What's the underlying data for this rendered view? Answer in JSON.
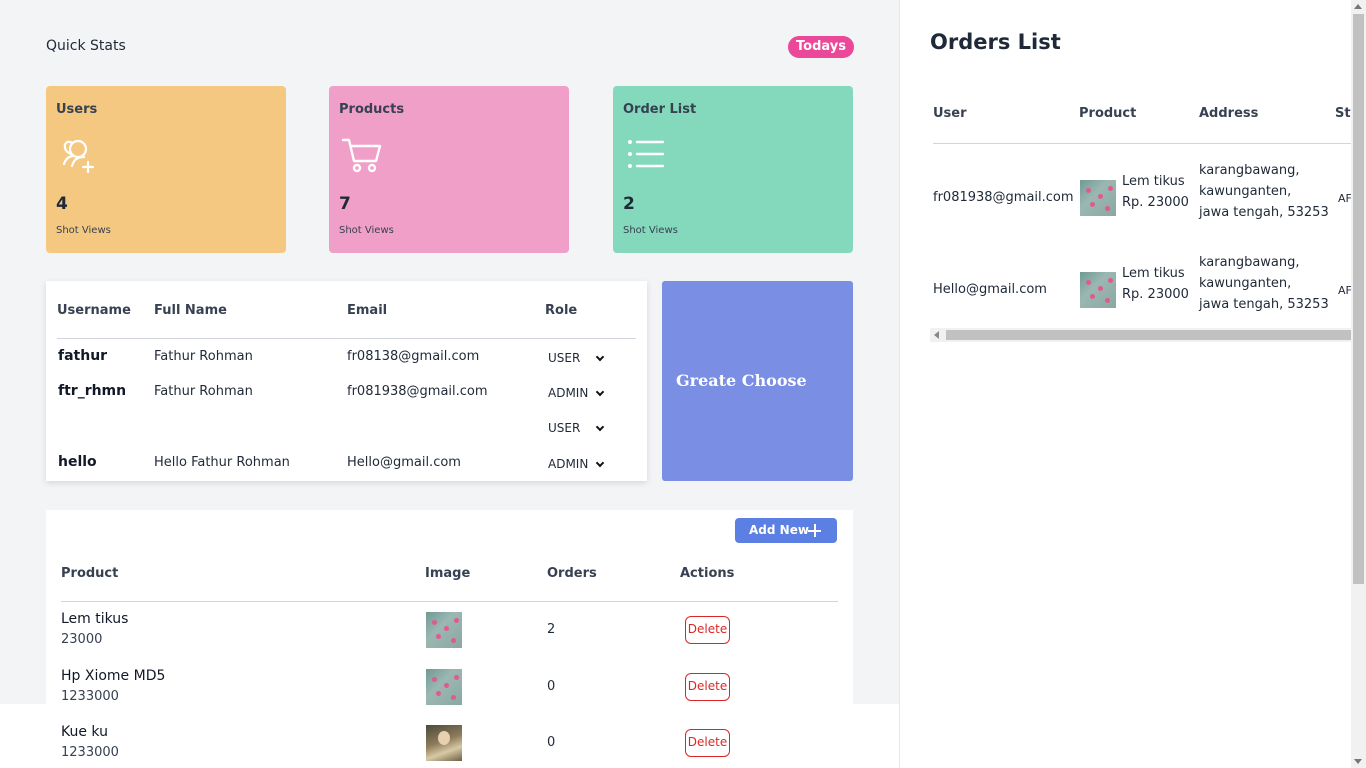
{
  "quick_stats": {
    "title": "Quick Stats",
    "badge": "Todays",
    "cards": [
      {
        "title": "Users",
        "count": "4",
        "sub": "Shot Views",
        "icon": "user-add-icon",
        "color": "#f5c882"
      },
      {
        "title": "Products",
        "count": "7",
        "sub": "Shot Views",
        "icon": "cart-icon",
        "color": "#f09fc8"
      },
      {
        "title": "Order List",
        "count": "2",
        "sub": "Shot Views",
        "icon": "list-icon",
        "color": "#84d9bd"
      }
    ]
  },
  "users_table": {
    "headers": {
      "username": "Username",
      "full_name": "Full Name",
      "email": "Email",
      "role": "Role"
    },
    "rows": [
      {
        "username": "fathur",
        "full_name": "Fathur Rohman",
        "email": "fr08138@gmail.com",
        "role": "USER"
      },
      {
        "username": "ftr_rhmn",
        "full_name": "Fathur Rohman",
        "email": "fr081938@gmail.com",
        "role": "ADMIN"
      },
      {
        "username": "",
        "full_name": "",
        "email": "",
        "role": "USER"
      },
      {
        "username": "hello",
        "full_name": "Hello Fathur Rohman",
        "email": "Hello@gmail.com",
        "role": "ADMIN"
      }
    ]
  },
  "greate_choose": {
    "label": "Greate Choose",
    "color": "#7a8ee3"
  },
  "products_table": {
    "add_new_label": "Add New",
    "headers": {
      "product": "Product",
      "image": "Image",
      "orders": "Orders",
      "actions": "Actions"
    },
    "rows": [
      {
        "name": "Lem tikus",
        "price": "23000",
        "orders": "2",
        "action": "Delete",
        "image": "flower-thumbnail"
      },
      {
        "name": "Hp Xiome MD5",
        "price": "1233000",
        "orders": "0",
        "action": "Delete",
        "image": "flower-thumbnail"
      },
      {
        "name": "Kue ku",
        "price": "1233000",
        "orders": "0",
        "action": "Delete",
        "image": "portrait-thumbnail"
      }
    ]
  },
  "orders_list": {
    "title": "Orders List",
    "headers": {
      "user": "User",
      "product": "Product",
      "address": "Address",
      "status": "St"
    },
    "rows": [
      {
        "user": "fr081938@gmail.com",
        "product_name": "Lem tikus",
        "product_price": "Rp. 23000",
        "address_1": "karangbawang,",
        "address_2": "kawunganten,",
        "address_3": "jawa tengah, 53253",
        "status": "AF"
      },
      {
        "user": "Hello@gmail.com",
        "product_name": "Lem tikus",
        "product_price": "Rp. 23000",
        "address_1": "karangbawang,",
        "address_2": "kawunganten,",
        "address_3": "jawa tengah, 53253",
        "status": "AF"
      }
    ]
  },
  "colors": {
    "badge": "#ec4899",
    "add_new": "#5b7fe2",
    "delete": "#dc2626"
  }
}
